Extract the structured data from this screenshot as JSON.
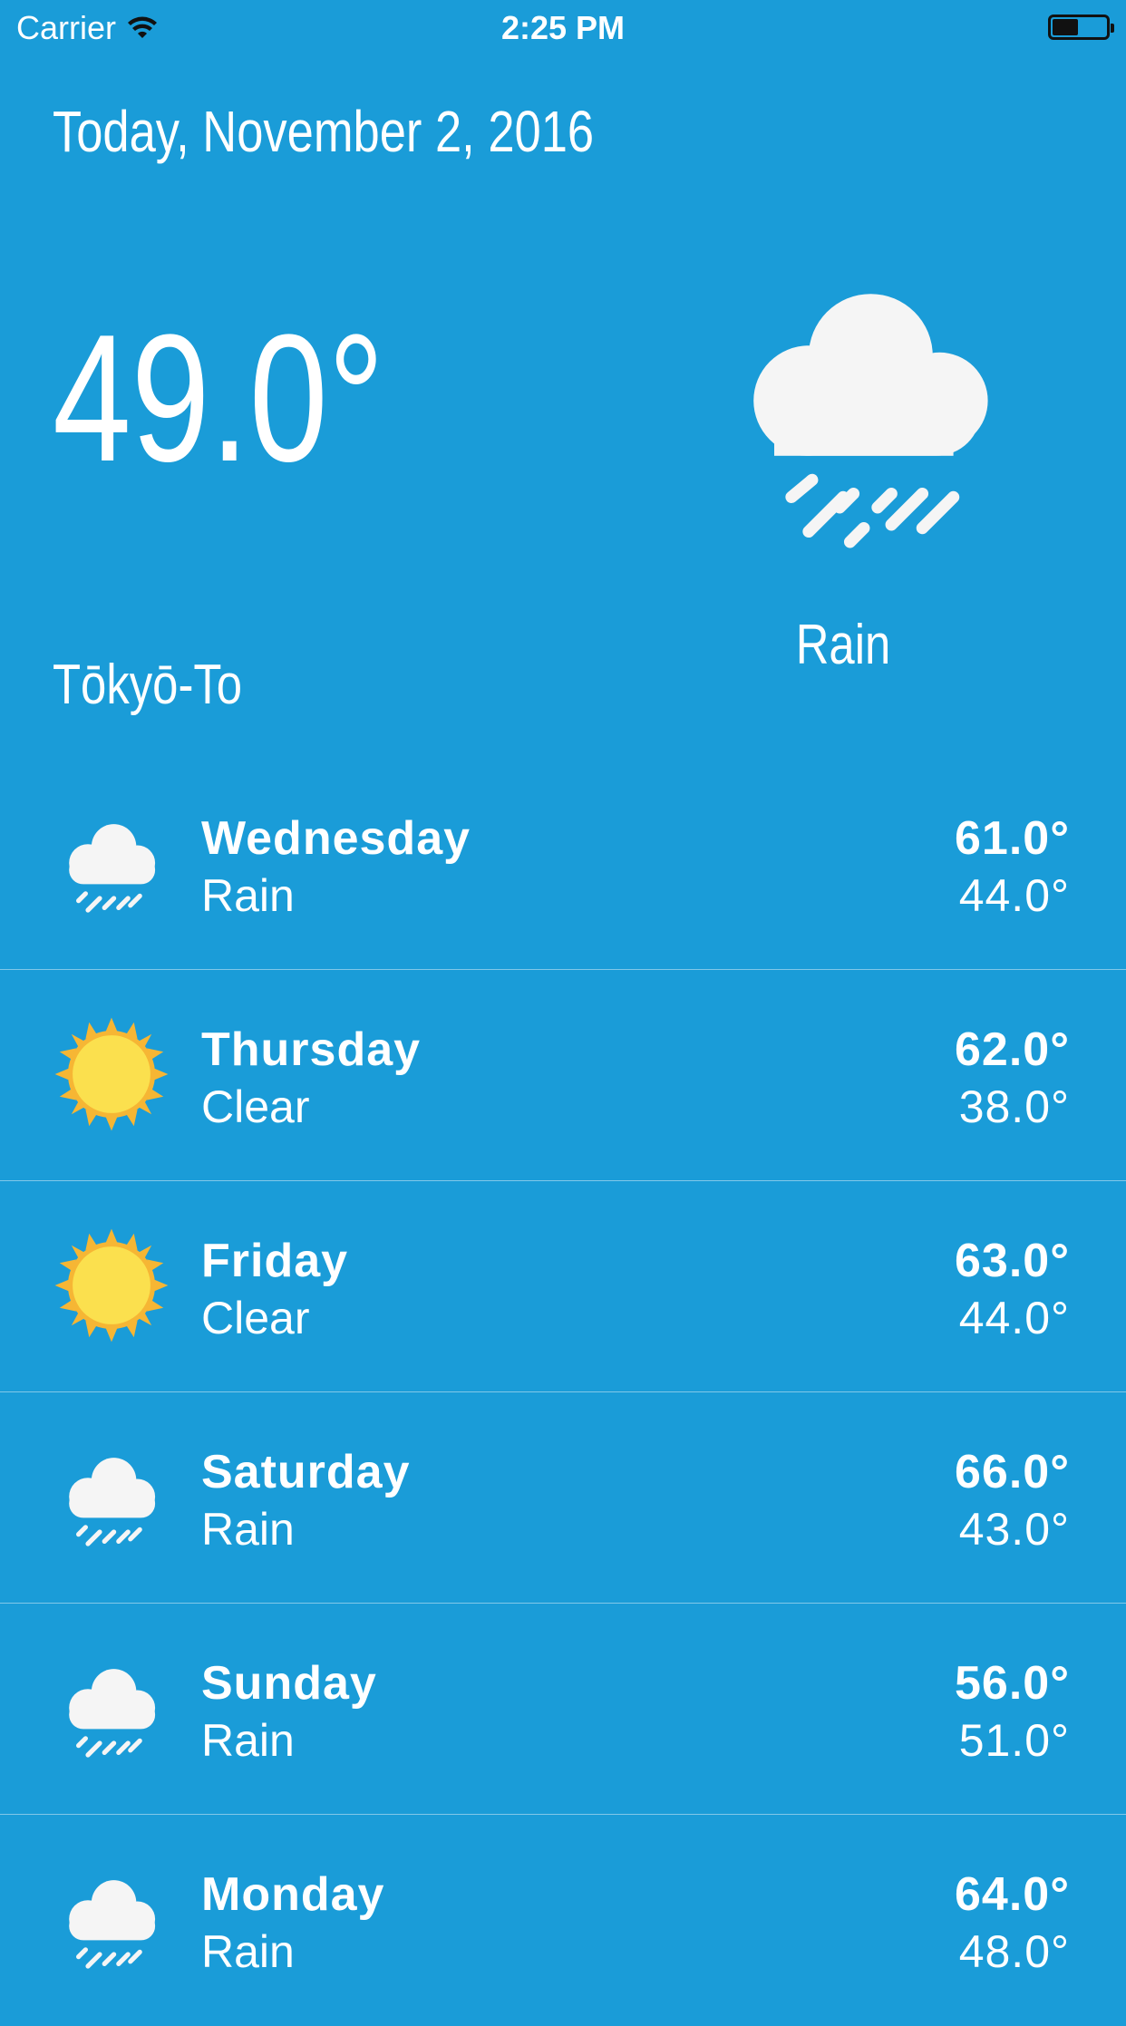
{
  "status_bar": {
    "carrier": "Carrier",
    "time": "2:25 PM",
    "wifi_icon": "wifi-icon",
    "battery_level": 0.45
  },
  "current": {
    "date": "Today, November 2, 2016",
    "temperature": "49.0°",
    "location": "Tōkyō-To",
    "condition": "Rain",
    "icon": "rain-cloud-icon"
  },
  "forecast": [
    {
      "day": "Wednesday",
      "condition": "Rain",
      "high": "61.0°",
      "low": "44.0°",
      "icon": "rain-cloud-icon"
    },
    {
      "day": "Thursday",
      "condition": "Clear",
      "high": "62.0°",
      "low": "38.0°",
      "icon": "sun-icon"
    },
    {
      "day": "Friday",
      "condition": "Clear",
      "high": "63.0°",
      "low": "44.0°",
      "icon": "sun-icon"
    },
    {
      "day": "Saturday",
      "condition": "Rain",
      "high": "66.0°",
      "low": "43.0°",
      "icon": "rain-cloud-icon"
    },
    {
      "day": "Sunday",
      "condition": "Rain",
      "high": "56.0°",
      "low": "51.0°",
      "icon": "rain-cloud-icon"
    },
    {
      "day": "Monday",
      "condition": "Rain",
      "high": "64.0°",
      "low": "48.0°",
      "icon": "rain-cloud-icon"
    }
  ],
  "colors": {
    "background": "#1a9cd8",
    "text": "#ffffff",
    "sun": "#fbe04e",
    "sun_rays": "#f6b634",
    "cloud": "#f5f5f5"
  }
}
